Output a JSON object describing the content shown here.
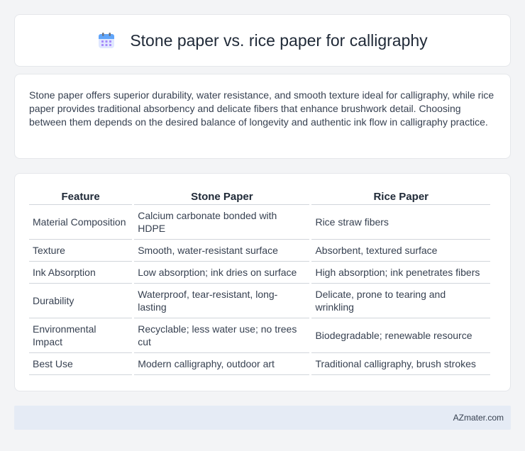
{
  "header": {
    "icon": "calendar-icon",
    "title": "Stone paper vs. rice paper for calligraphy"
  },
  "summary": {
    "text": "Stone paper offers superior durability, water resistance, and smooth texture ideal for calligraphy, while rice paper provides traditional absorbency and delicate fibers that enhance brushwork detail. Choosing between them depends on the desired balance of longevity and authentic ink flow in calligraphy practice."
  },
  "table": {
    "headers": [
      "Feature",
      "Stone Paper",
      "Rice Paper"
    ],
    "rows": [
      [
        "Material Composition",
        "Calcium carbonate bonded with HDPE",
        "Rice straw fibers"
      ],
      [
        "Texture",
        "Smooth, water-resistant surface",
        "Absorbent, textured surface"
      ],
      [
        "Ink Absorption",
        "Low absorption; ink dries on surface",
        "High absorption; ink penetrates fibers"
      ],
      [
        "Durability",
        "Waterproof, tear-resistant, long-lasting",
        "Delicate, prone to tearing and wrinkling"
      ],
      [
        "Environmental Impact",
        "Recyclable; less water use; no trees cut",
        "Biodegradable; renewable resource"
      ],
      [
        "Best Use",
        "Modern calligraphy, outdoor art",
        "Traditional calligraphy, brush strokes"
      ]
    ]
  },
  "footer": {
    "brand": "AZmater.com"
  },
  "colors": {
    "background": "#f3f4f6",
    "card": "#ffffff",
    "footer_bg": "#e5ebf5",
    "icon_accent": "#3b82f6"
  }
}
